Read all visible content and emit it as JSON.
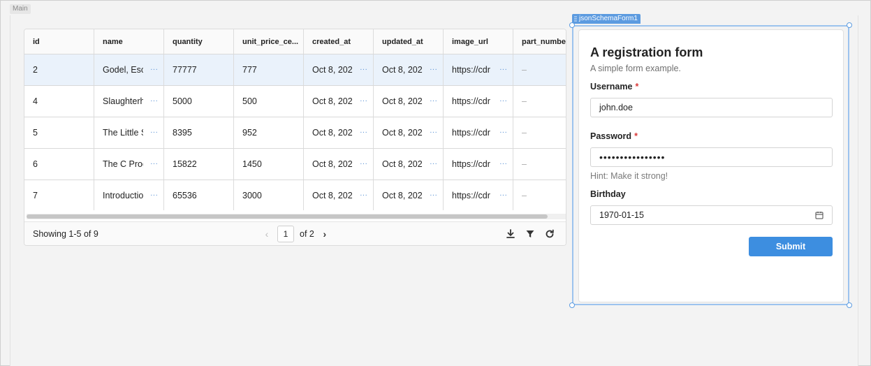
{
  "workspace": {
    "main_label": "Main"
  },
  "table": {
    "columns": [
      "id",
      "name",
      "quantity",
      "unit_price_ce...",
      "created_at",
      "updated_at",
      "image_url",
      "part_numbe"
    ],
    "rows": [
      {
        "id": "2",
        "name": "Godel, Esc",
        "quantity": "77777",
        "unit_price": "777",
        "created_at": "Oct 8, 202",
        "updated_at": "Oct 8, 202",
        "image_url": "https://cdr",
        "part_number": "–"
      },
      {
        "id": "4",
        "name": "Slaughterh",
        "quantity": "5000",
        "unit_price": "500",
        "created_at": "Oct 8, 202",
        "updated_at": "Oct 8, 202",
        "image_url": "https://cdr",
        "part_number": "–"
      },
      {
        "id": "5",
        "name": "The Little S",
        "quantity": "8395",
        "unit_price": "952",
        "created_at": "Oct 8, 202",
        "updated_at": "Oct 8, 202",
        "image_url": "https://cdr",
        "part_number": "–"
      },
      {
        "id": "6",
        "name": "The C Prog",
        "quantity": "15822",
        "unit_price": "1450",
        "created_at": "Oct 8, 202",
        "updated_at": "Oct 8, 202",
        "image_url": "https://cdr",
        "part_number": "–"
      },
      {
        "id": "7",
        "name": "Introductio",
        "quantity": "65536",
        "unit_price": "3000",
        "created_at": "Oct 8, 202",
        "updated_at": "Oct 8, 202",
        "image_url": "https://cdr",
        "part_number": "–"
      }
    ],
    "more_glyph": "···",
    "footer": {
      "showing": "Showing 1-5 of 9",
      "page": "1",
      "of_pages": "of 2",
      "prev_glyph": "‹",
      "next_glyph": "›"
    },
    "icons": [
      "download-icon",
      "filter-icon",
      "refresh-icon"
    ]
  },
  "component": {
    "tag": "jsonSchemaForm1"
  },
  "form": {
    "title": "A registration form",
    "description": "A simple form example.",
    "username": {
      "label": "Username",
      "required_mark": "*",
      "value": "john.doe"
    },
    "password": {
      "label": "Password",
      "required_mark": "*",
      "value": "••••••••••••••••",
      "hint": "Hint: Make it strong!"
    },
    "birthday": {
      "label": "Birthday",
      "value": "1970-01-15",
      "icon": "calendar-icon"
    },
    "submit_label": "Submit"
  },
  "colors": {
    "accent": "#3d8ee0",
    "selection": "#9cc3ee",
    "required": "#d93838",
    "selected_row": "#eaf2fb"
  }
}
